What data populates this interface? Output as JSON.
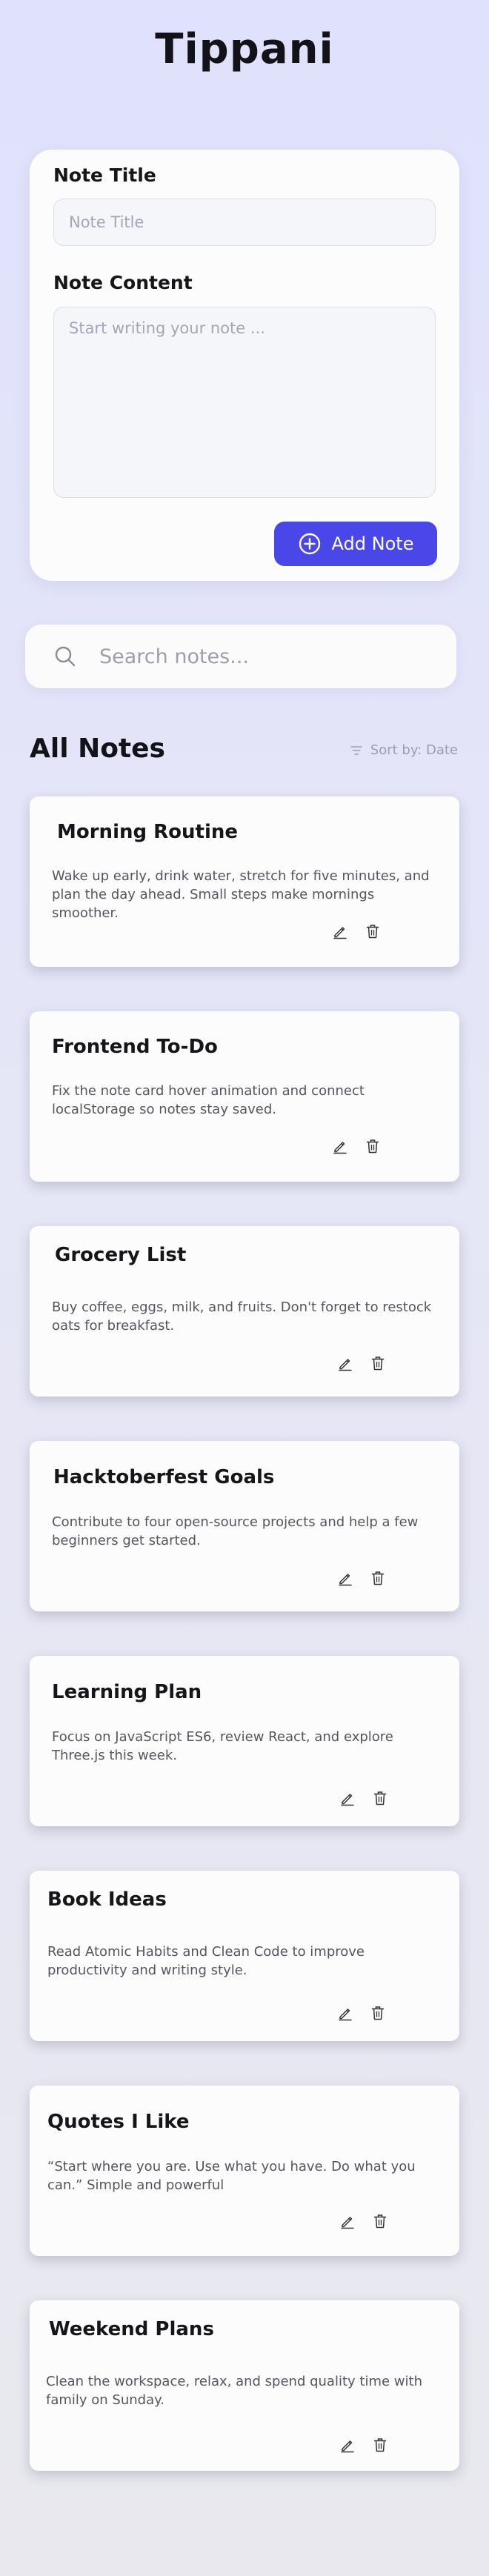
{
  "app": {
    "title": "Tippani"
  },
  "composer": {
    "title_label": "Note Title",
    "title_placeholder": "Note Title",
    "title_value": "",
    "content_label": "Note Content",
    "content_placeholder": "Start writing your note ...",
    "content_value": "",
    "add_label": "Add Note",
    "accent_color": "#4a47e8"
  },
  "search": {
    "placeholder": "Search notes...",
    "value": ""
  },
  "notes_section": {
    "title": "All Notes",
    "sort_label": "Sort by: Date"
  },
  "notes": [
    {
      "title": "Morning Routine",
      "body": "Wake up early, drink water, stretch for five minutes, and plan the day ahead. Small steps make mornings smoother."
    },
    {
      "title": "Frontend To-Do",
      "body": "Fix the note card hover animation and connect localStorage so notes stay saved."
    },
    {
      "title": "Grocery List",
      "body": "Buy coffee, eggs, milk, and fruits. Don't forget to restock oats for breakfast."
    },
    {
      "title": "Hacktoberfest Goals",
      "body": "Contribute to four open-source projects and help a few beginners get started."
    },
    {
      "title": "Learning Plan",
      "body": "Focus on JavaScript ES6, review React, and explore Three.js this week."
    },
    {
      "title": "Book Ideas",
      "body": "Read Atomic Habits and Clean Code to improve productivity and writing style."
    },
    {
      "title": "Quotes I Like",
      "body": "“Start where you are. Use what you have. Do what you can.” Simple and powerful"
    },
    {
      "title": "Weekend Plans",
      "body": "Clean the workspace, relax, and spend quality time with family on Sunday."
    }
  ]
}
